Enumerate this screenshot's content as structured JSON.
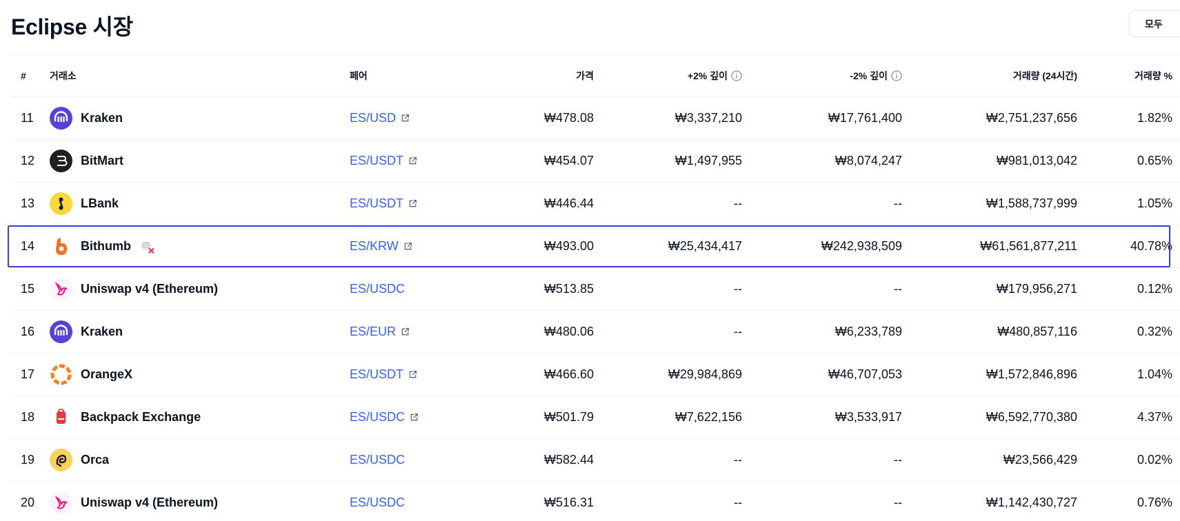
{
  "title": "Eclipse 시장",
  "filter_button": "모두",
  "header": {
    "rank": "#",
    "exchange": "거래소",
    "pair": "페어",
    "price": "가격",
    "depth_plus": "+2% 깊이",
    "depth_minus": "-2% 깊이",
    "volume": "거래량 (24시간)",
    "volume_pct": "거래량 %"
  },
  "rows": [
    {
      "rank": "11",
      "exchange": "Kraken",
      "logo": "kraken",
      "pair": "ES/USD",
      "external": true,
      "price": "₩478.08",
      "depth_plus": "₩3,337,210",
      "depth_minus": "₩17,761,400",
      "volume": "₩2,751,237,656",
      "volume_pct": "1.82%"
    },
    {
      "rank": "12",
      "exchange": "BitMart",
      "logo": "bitmart",
      "pair": "ES/USDT",
      "external": true,
      "price": "₩454.07",
      "depth_plus": "₩1,497,955",
      "depth_minus": "₩8,074,247",
      "volume": "₩981,013,042",
      "volume_pct": "0.65%"
    },
    {
      "rank": "13",
      "exchange": "LBank",
      "logo": "lbank",
      "pair": "ES/USDT",
      "external": true,
      "price": "₩446.44",
      "depth_plus": "--",
      "depth_minus": "--",
      "volume": "₩1,588,737,999",
      "volume_pct": "1.05%"
    },
    {
      "rank": "14",
      "exchange": "Bithumb",
      "logo": "bithumb",
      "pair": "ES/KRW",
      "external": true,
      "price": "₩493.00",
      "depth_plus": "₩25,434,417",
      "depth_minus": "₩242,938,509",
      "volume": "₩61,561,877,211",
      "volume_pct": "40.78%",
      "highlighted": true,
      "warning_icon": "excluded-data-icon"
    },
    {
      "rank": "15",
      "exchange": "Uniswap v4 (Ethereum)",
      "logo": "uniswap",
      "pair": "ES/USDC",
      "external": false,
      "price": "₩513.85",
      "depth_plus": "--",
      "depth_minus": "--",
      "volume": "₩179,956,271",
      "volume_pct": "0.12%"
    },
    {
      "rank": "16",
      "exchange": "Kraken",
      "logo": "kraken",
      "pair": "ES/EUR",
      "external": true,
      "price": "₩480.06",
      "depth_plus": "--",
      "depth_minus": "₩6,233,789",
      "volume": "₩480,857,116",
      "volume_pct": "0.32%"
    },
    {
      "rank": "17",
      "exchange": "OrangeX",
      "logo": "orangex",
      "pair": "ES/USDT",
      "external": true,
      "price": "₩466.60",
      "depth_plus": "₩29,984,869",
      "depth_minus": "₩46,707,053",
      "volume": "₩1,572,846,896",
      "volume_pct": "1.04%"
    },
    {
      "rank": "18",
      "exchange": "Backpack Exchange",
      "logo": "backpack",
      "pair": "ES/USDC",
      "external": true,
      "price": "₩501.79",
      "depth_plus": "₩7,622,156",
      "depth_minus": "₩3,533,917",
      "volume": "₩6,592,770,380",
      "volume_pct": "4.37%"
    },
    {
      "rank": "19",
      "exchange": "Orca",
      "logo": "orca",
      "pair": "ES/USDC",
      "external": false,
      "price": "₩582.44",
      "depth_plus": "--",
      "depth_minus": "--",
      "volume": "₩23,566,429",
      "volume_pct": "0.02%"
    },
    {
      "rank": "20",
      "exchange": "Uniswap v4 (Ethereum)",
      "logo": "uniswap",
      "pair": "ES/USDC",
      "external": false,
      "price": "₩516.31",
      "depth_plus": "--",
      "depth_minus": "--",
      "volume": "₩1,142,430,727",
      "volume_pct": "0.76%"
    }
  ],
  "colors": {
    "link": "#3861fb",
    "highlight_border": "#3b3fd1",
    "kraken": "#5741d9",
    "bitmart": "#1f1f1f",
    "lbank": "#f7d83b",
    "bithumb": "#f37321",
    "uniswap": "#ff007a",
    "orangex": "#f58220",
    "backpack": "#e33e3f",
    "orca": "#ffd15c"
  }
}
